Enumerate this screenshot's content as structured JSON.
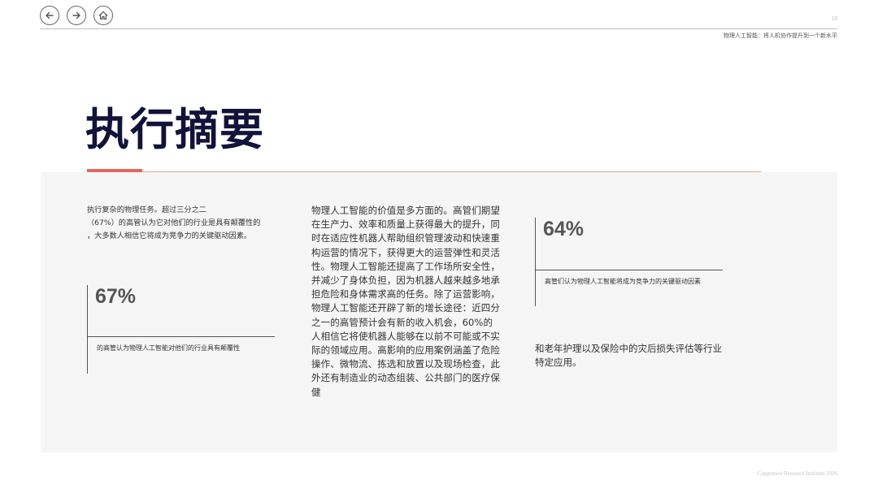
{
  "nav": {
    "back_icon": "arrow-left-icon",
    "forward_icon": "arrow-right-icon",
    "home_icon": "home-icon"
  },
  "header": {
    "page_number": "10",
    "running_title": "物理人工智能：将人机协作提升到一个新水平"
  },
  "title": "执行摘要",
  "accent_color": "#e0685c",
  "column1": {
    "text": "执行复杂的物理任务。超过三分之二\n（67%）的高管认为它对他们的行业是具有颠覆性的\n，大多数人相信它将成为竞争力的关键驱动因素。",
    "stat_value": "67%",
    "stat_caption": "的高管认为物理人工智能对他们的行业具有颠覆性"
  },
  "column2": {
    "text": "物理人工智能的价值是多方面的。高管们期望在生产力、效率和质量上获得最大的提升，同时在适应性机器人帮助组织管理波动和快速重构运营的情况下，获得更大的运营弹性和灵活性。物理人工智能还提高了工作场所安全性，并减少了身体负担，因为机器人越来越多地承担危险和身体需求高的任务。除了运营影响，物理人工智能还开辟了新的增长途径：近四分之一的高管预计会有新的收入机会，60%的人相信它将使机器人能够在以前不可能或不实际的领域应用。高影响的应用案例涵盖了危险操作、微物流、拣选和放置以及现场检查，此外还有制造业的动态组装、公共部门的医疗保健"
  },
  "column3": {
    "stat_value": "64%",
    "stat_caption": "高管们认为物理人工智能将成为竞争力的关键驱动因素",
    "text": "和老年护理以及保险中的灾后损失评估等行业特定应用。"
  },
  "footer": "Capgemini Research Institute 2026"
}
